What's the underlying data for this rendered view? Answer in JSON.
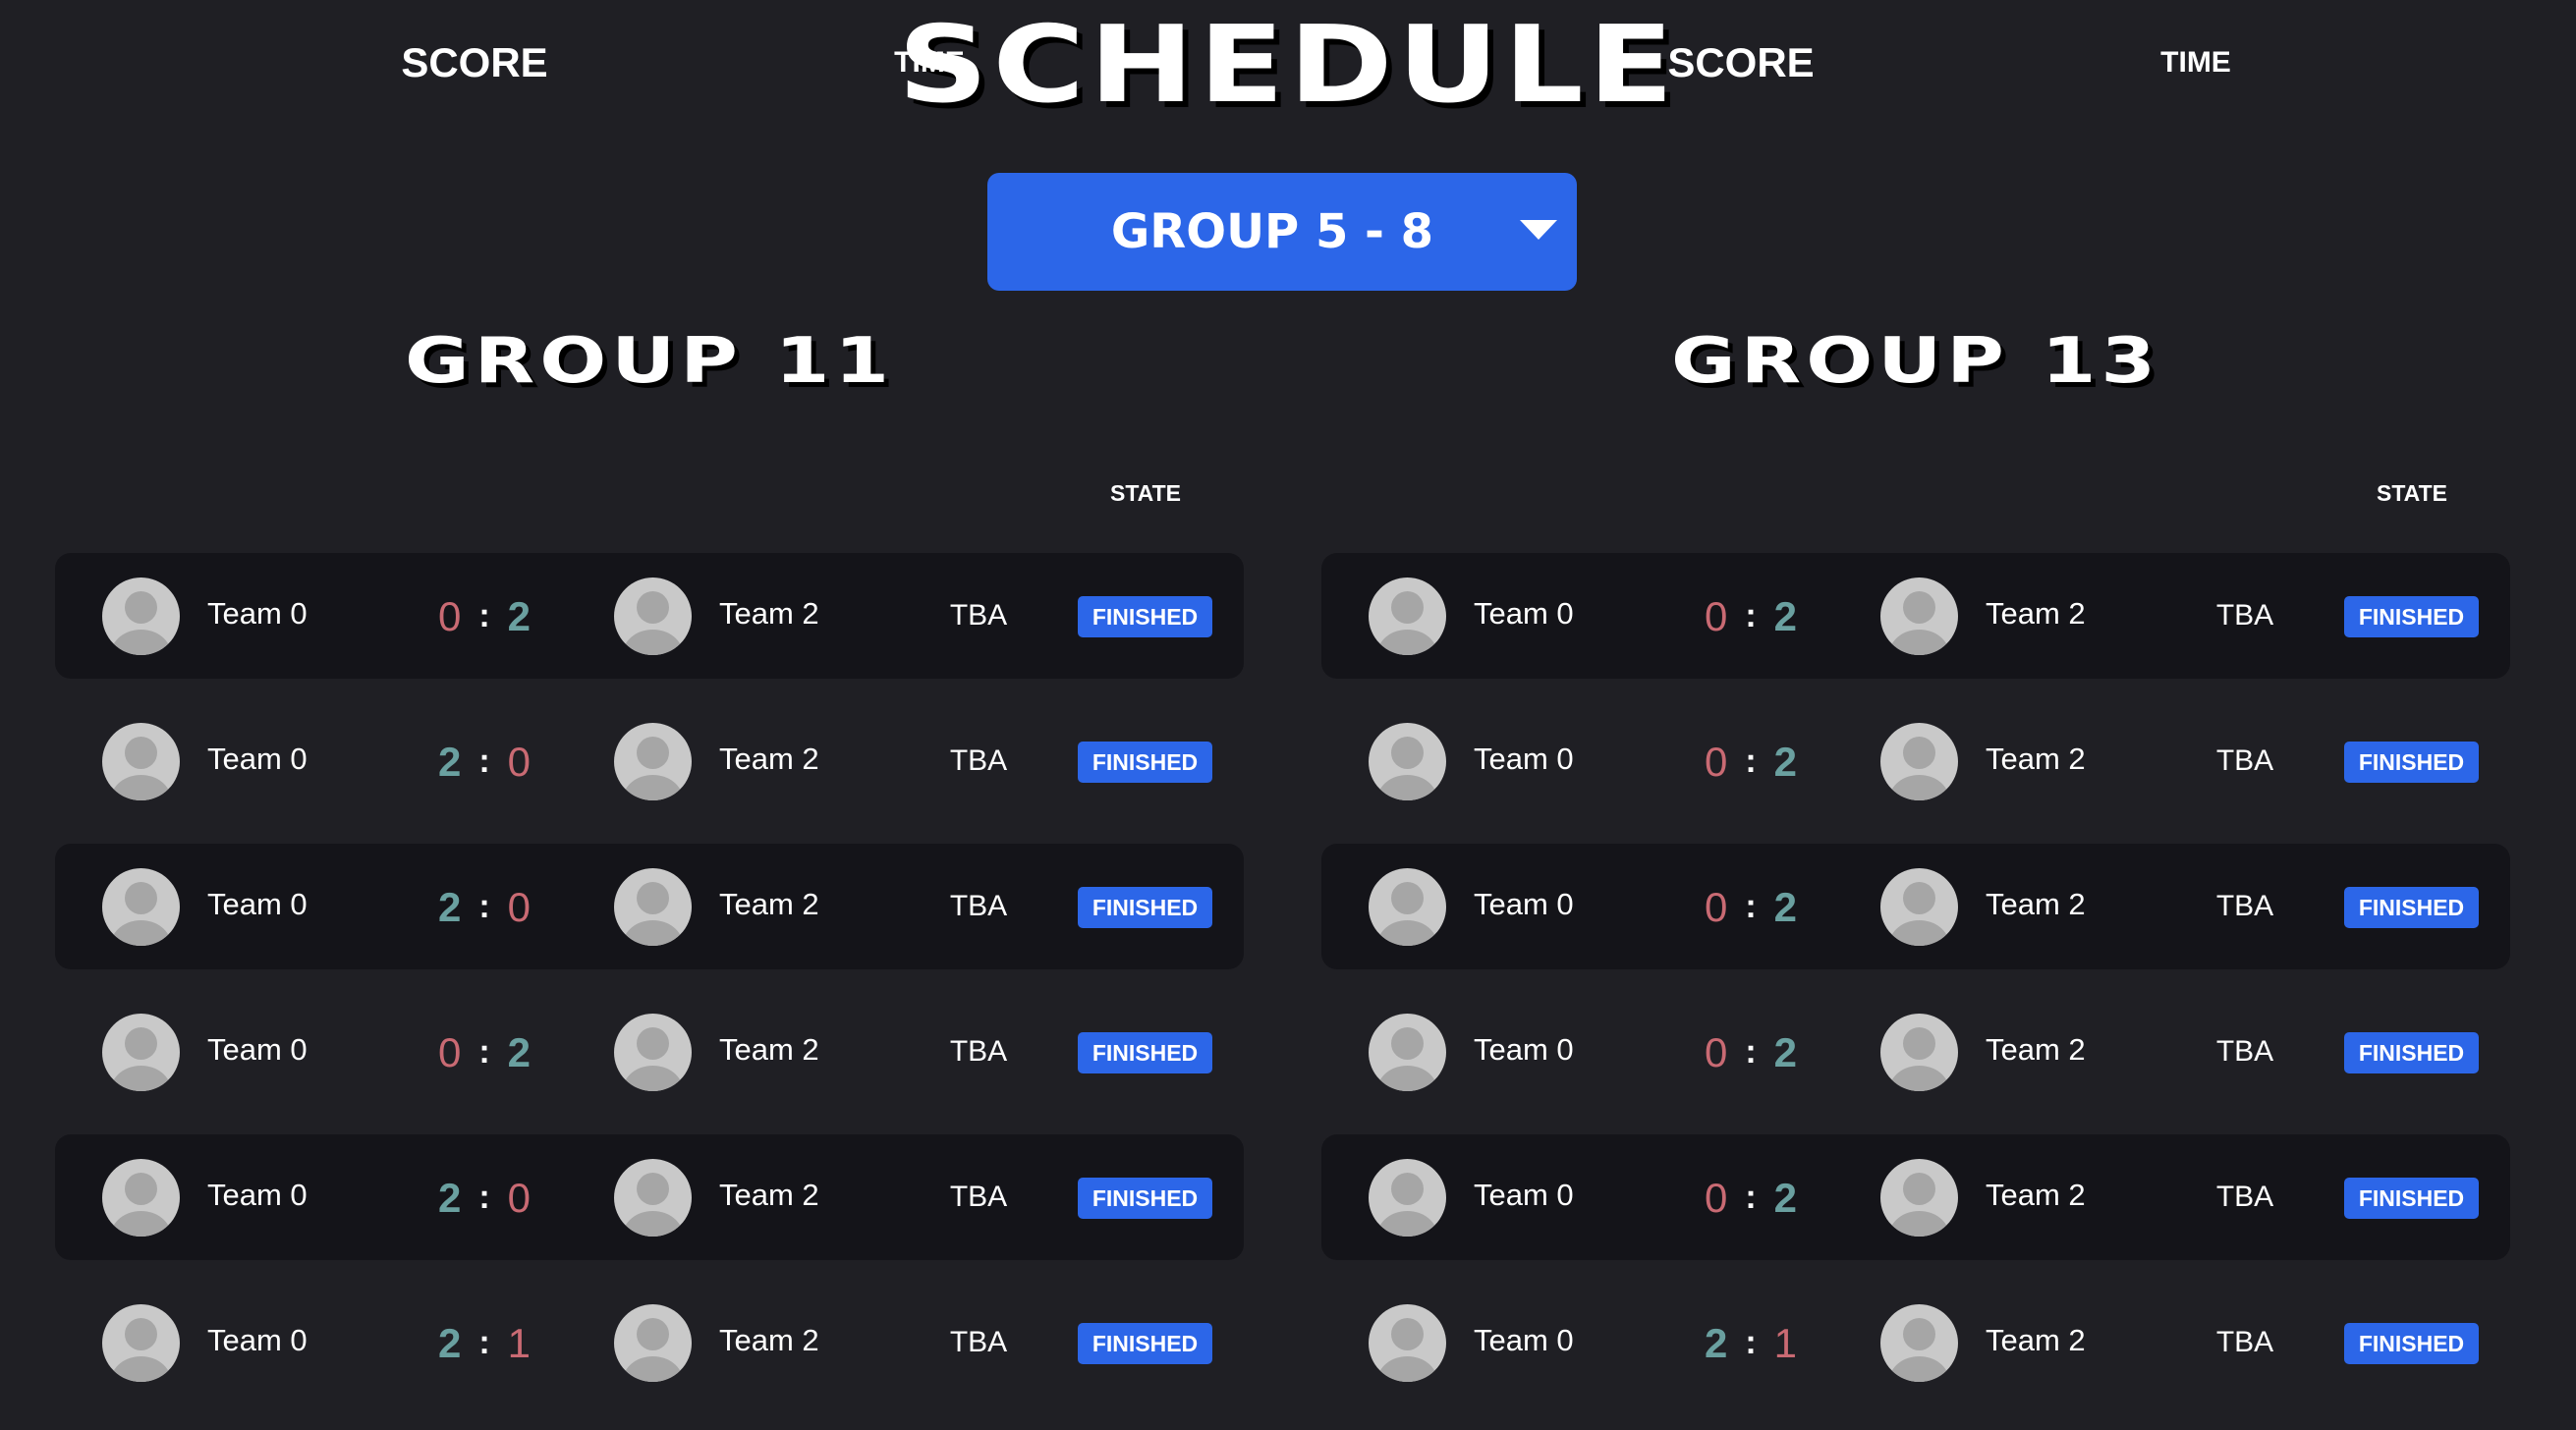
{
  "page": {
    "title": "SCHEDULE"
  },
  "group_select": {
    "label": "GROUP 5 - 8"
  },
  "columns": {
    "score": "SCORE",
    "time": "TIME",
    "state": "STATE"
  },
  "groups": [
    {
      "title": "GROUP 11",
      "matches": [
        {
          "team1": "Team 0",
          "team2": "Team 2",
          "score1": "0",
          "score2": "2",
          "time": "TBA",
          "state": "FINISHED"
        },
        {
          "team1": "Team 0",
          "team2": "Team 2",
          "score1": "2",
          "score2": "0",
          "time": "TBA",
          "state": "FINISHED"
        },
        {
          "team1": "Team 0",
          "team2": "Team 2",
          "score1": "2",
          "score2": "0",
          "time": "TBA",
          "state": "FINISHED"
        },
        {
          "team1": "Team 0",
          "team2": "Team 2",
          "score1": "0",
          "score2": "2",
          "time": "TBA",
          "state": "FINISHED"
        },
        {
          "team1": "Team 0",
          "team2": "Team 2",
          "score1": "2",
          "score2": "0",
          "time": "TBA",
          "state": "FINISHED"
        },
        {
          "team1": "Team 0",
          "team2": "Team 2",
          "score1": "2",
          "score2": "1",
          "time": "TBA",
          "state": "FINISHED"
        }
      ]
    },
    {
      "title": "GROUP 13",
      "matches": [
        {
          "team1": "Team 0",
          "team2": "Team 2",
          "score1": "0",
          "score2": "2",
          "time": "TBA",
          "state": "FINISHED"
        },
        {
          "team1": "Team 0",
          "team2": "Team 2",
          "score1": "0",
          "score2": "2",
          "time": "TBA",
          "state": "FINISHED"
        },
        {
          "team1": "Team 0",
          "team2": "Team 2",
          "score1": "0",
          "score2": "2",
          "time": "TBA",
          "state": "FINISHED"
        },
        {
          "team1": "Team 0",
          "team2": "Team 2",
          "score1": "0",
          "score2": "2",
          "time": "TBA",
          "state": "FINISHED"
        },
        {
          "team1": "Team 0",
          "team2": "Team 2",
          "score1": "0",
          "score2": "2",
          "time": "TBA",
          "state": "FINISHED"
        },
        {
          "team1": "Team 0",
          "team2": "Team 2",
          "score1": "2",
          "score2": "1",
          "time": "TBA",
          "state": "FINISHED"
        }
      ]
    }
  ],
  "colors": {
    "background": "#1f1f24",
    "row_dark": "#141419",
    "accent_blue": "#2c66e8",
    "score_high": "#6aa0a0",
    "score_low": "#c96a73"
  },
  "icons": {
    "avatar": "user-avatar-icon",
    "dropdown": "chevron-down-icon"
  }
}
